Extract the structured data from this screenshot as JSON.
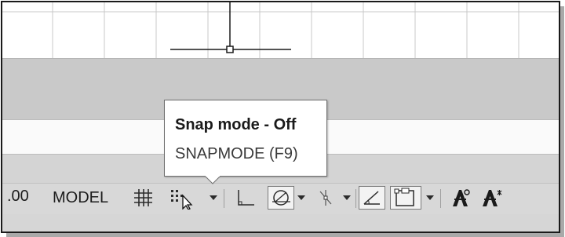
{
  "statusbar": {
    "coordinate_tail": ".00",
    "model_label": "MODEL",
    "tools": [
      {
        "icon": "grid-display-icon",
        "state": "off"
      },
      {
        "icon": "snap-mode-icon",
        "state": "off",
        "hovered": true
      },
      {
        "icon": "ortho-mode-icon",
        "state": "off"
      },
      {
        "icon": "polar-tracking-icon",
        "state": "on"
      },
      {
        "icon": "object-snap-tracking-icon",
        "state": "off"
      },
      {
        "icon": "dynamic-ucs-icon",
        "state": "on"
      },
      {
        "icon": "selection-cycling-icon",
        "state": "on"
      },
      {
        "icon": "annotation-visibility-icon",
        "state": "off"
      },
      {
        "icon": "auto-scale-icon",
        "state": "off"
      }
    ]
  },
  "tooltip": {
    "title": "Snap mode - Off",
    "command": "SNAPMODE (F9)"
  },
  "colors": {
    "panel_gray": "#c9c9c9",
    "statusbar": "#d8d8d8",
    "toggle_on_bg": "#f3f3f3"
  }
}
